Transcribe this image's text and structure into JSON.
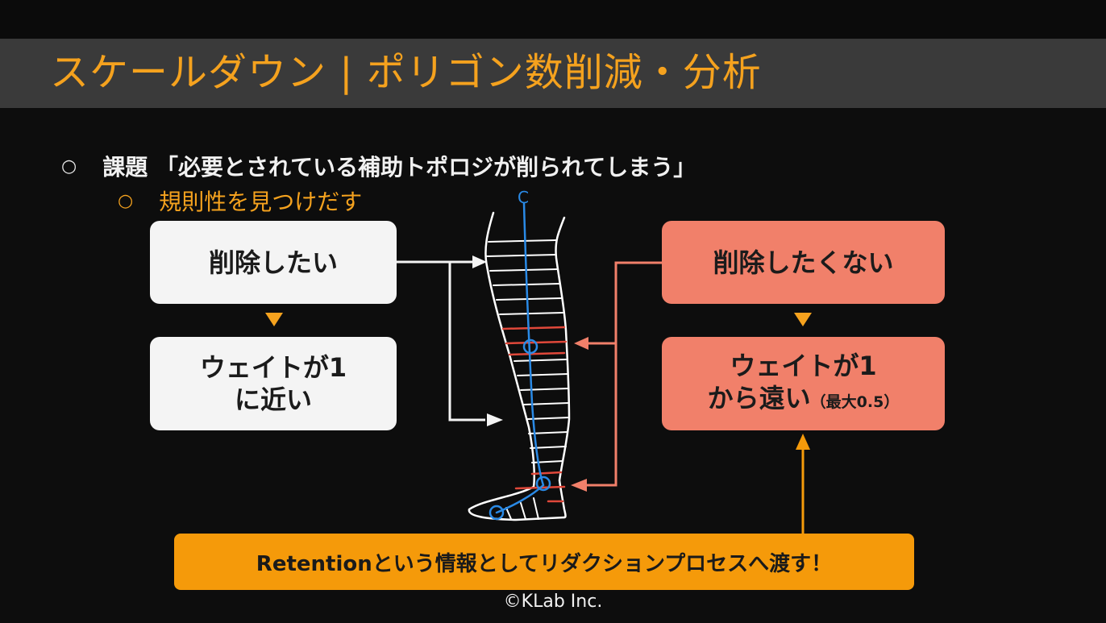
{
  "slide": {
    "title": "スケールダウン | ポリゴン数削減・分析",
    "bullet_symbol": "○",
    "bullet1": "課題 「必要とされている補助トポロジが削られてしまう」",
    "bullet2": "規則性を見つけだす",
    "box_delete": "削除したい",
    "box_weight_near_line1": "ウェイトが1",
    "box_weight_near_line2": "に近い",
    "box_keep": "削除したくない",
    "box_weight_far_line1": "ウェイトが1",
    "box_weight_far_line2": "から遠い",
    "box_weight_far_note": "（最大0.5）",
    "retention": "Retentionという情報としてリダクションプロセスへ渡す！",
    "sketch_label": "C",
    "copyright": "©KLab Inc."
  },
  "colors": {
    "accent_orange": "#f5a21e",
    "salmon": "#f1806a",
    "retention_orange": "#f59a0a",
    "bone_blue": "#2a8ae6",
    "edge_red": "#e0483a",
    "title_bar": "#3a3a3a"
  }
}
